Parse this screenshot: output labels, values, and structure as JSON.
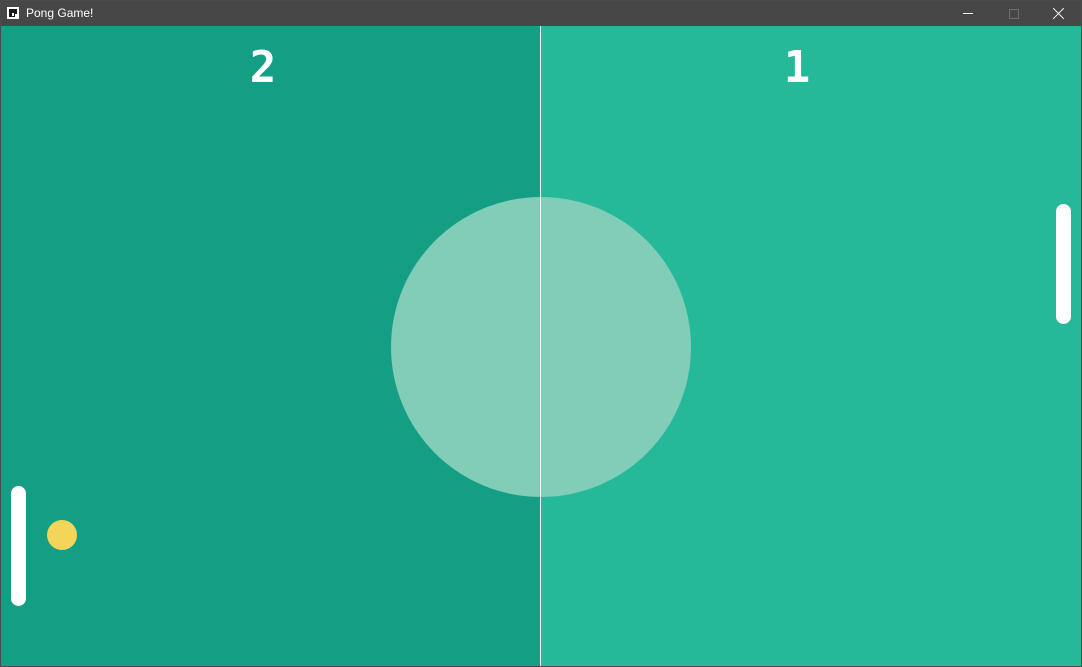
{
  "window": {
    "title": "Pong Game!",
    "icon": "app-icon"
  },
  "controls": {
    "minimize": "minimize-icon",
    "maximize": "maximize-icon",
    "close": "close-icon"
  },
  "scoreboard": {
    "player_left": "2",
    "player_right": "1"
  },
  "colors": {
    "left_half": "#149f84",
    "right_half": "#25b999",
    "center_circle": "#81cdb8",
    "paddle": "#ffffff",
    "ball": "#f3d55a"
  }
}
